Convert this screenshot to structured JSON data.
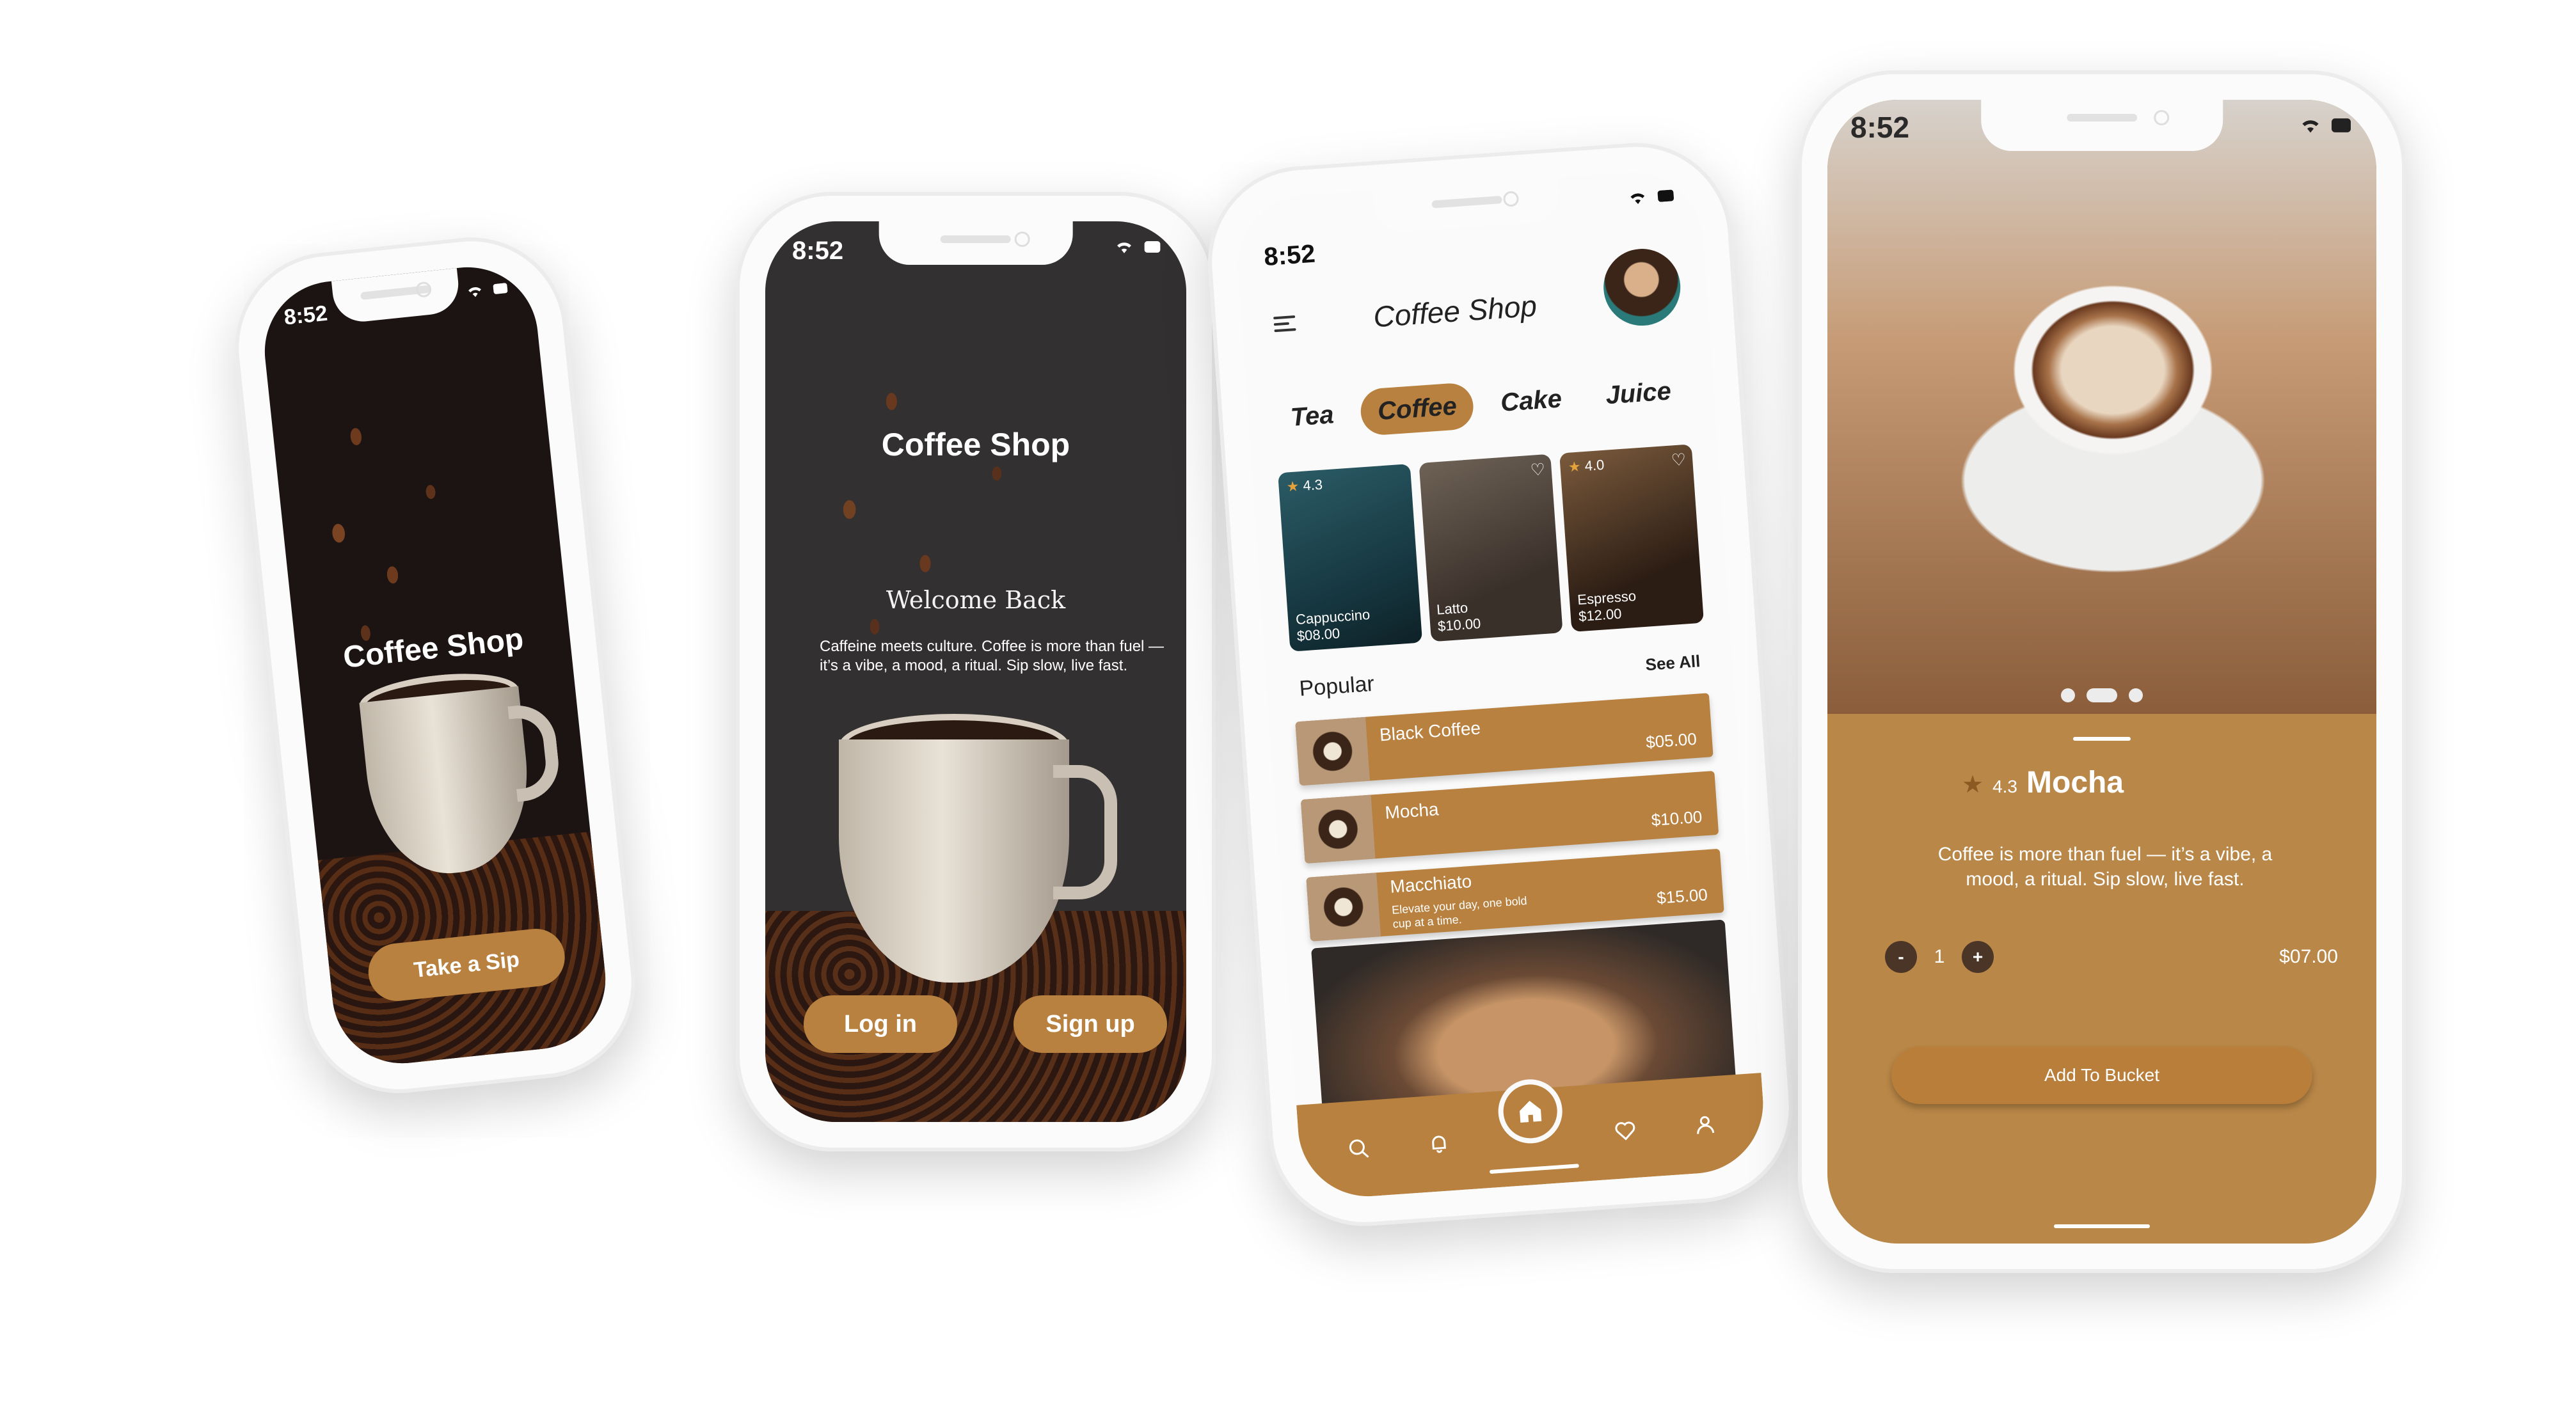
{
  "status": {
    "time": "8:52"
  },
  "colors": {
    "accent": "#b8813f",
    "detail_bg": "#b98747",
    "dark_bg": "#323030"
  },
  "splash": {
    "title": "Coffee Shop",
    "button": "Take a Sip"
  },
  "welcome": {
    "title": "Coffee Shop",
    "heading": "Welcome Back",
    "body": "Caffeine meets culture. Coffee is more than fuel — it’s a vibe, a mood, a ritual. Sip slow, live fast.",
    "login": "Log in",
    "signup": "Sign up"
  },
  "home": {
    "title": "Coffee Shop",
    "tabs": [
      "Tea",
      "Coffee",
      "Cake",
      "Juice"
    ],
    "active_tab": "Coffee",
    "cards": [
      {
        "name": "Cappuccino",
        "price": "$08.00",
        "rating": "4.3"
      },
      {
        "name": "Latto",
        "price": "$10.00",
        "rating": ""
      },
      {
        "name": "Espresso",
        "price": "$12.00",
        "rating": "4.0"
      }
    ],
    "popular_title": "Popular",
    "see_all": "See All",
    "popular": [
      {
        "name": "Black Coffee",
        "desc": "",
        "price": "$05.00"
      },
      {
        "name": "Mocha",
        "desc": "",
        "price": "$10.00"
      },
      {
        "name": "Macchiato",
        "desc": "Elevate your day, one bold cup at a time.",
        "price": "$15.00"
      }
    ],
    "nav_icons": [
      "search-icon",
      "bell-icon",
      "home-icon",
      "heart-icon",
      "user-icon"
    ]
  },
  "detail": {
    "rating": "4.3",
    "name": "Mocha",
    "description": "Coffee is more than fuel — it’s a vibe, a mood, a ritual. Sip slow, live fast.",
    "quantity": "1",
    "minus": "-",
    "plus": "+",
    "price": "$07.00",
    "button": "Add To Bucket",
    "carousel_dots": 3
  }
}
